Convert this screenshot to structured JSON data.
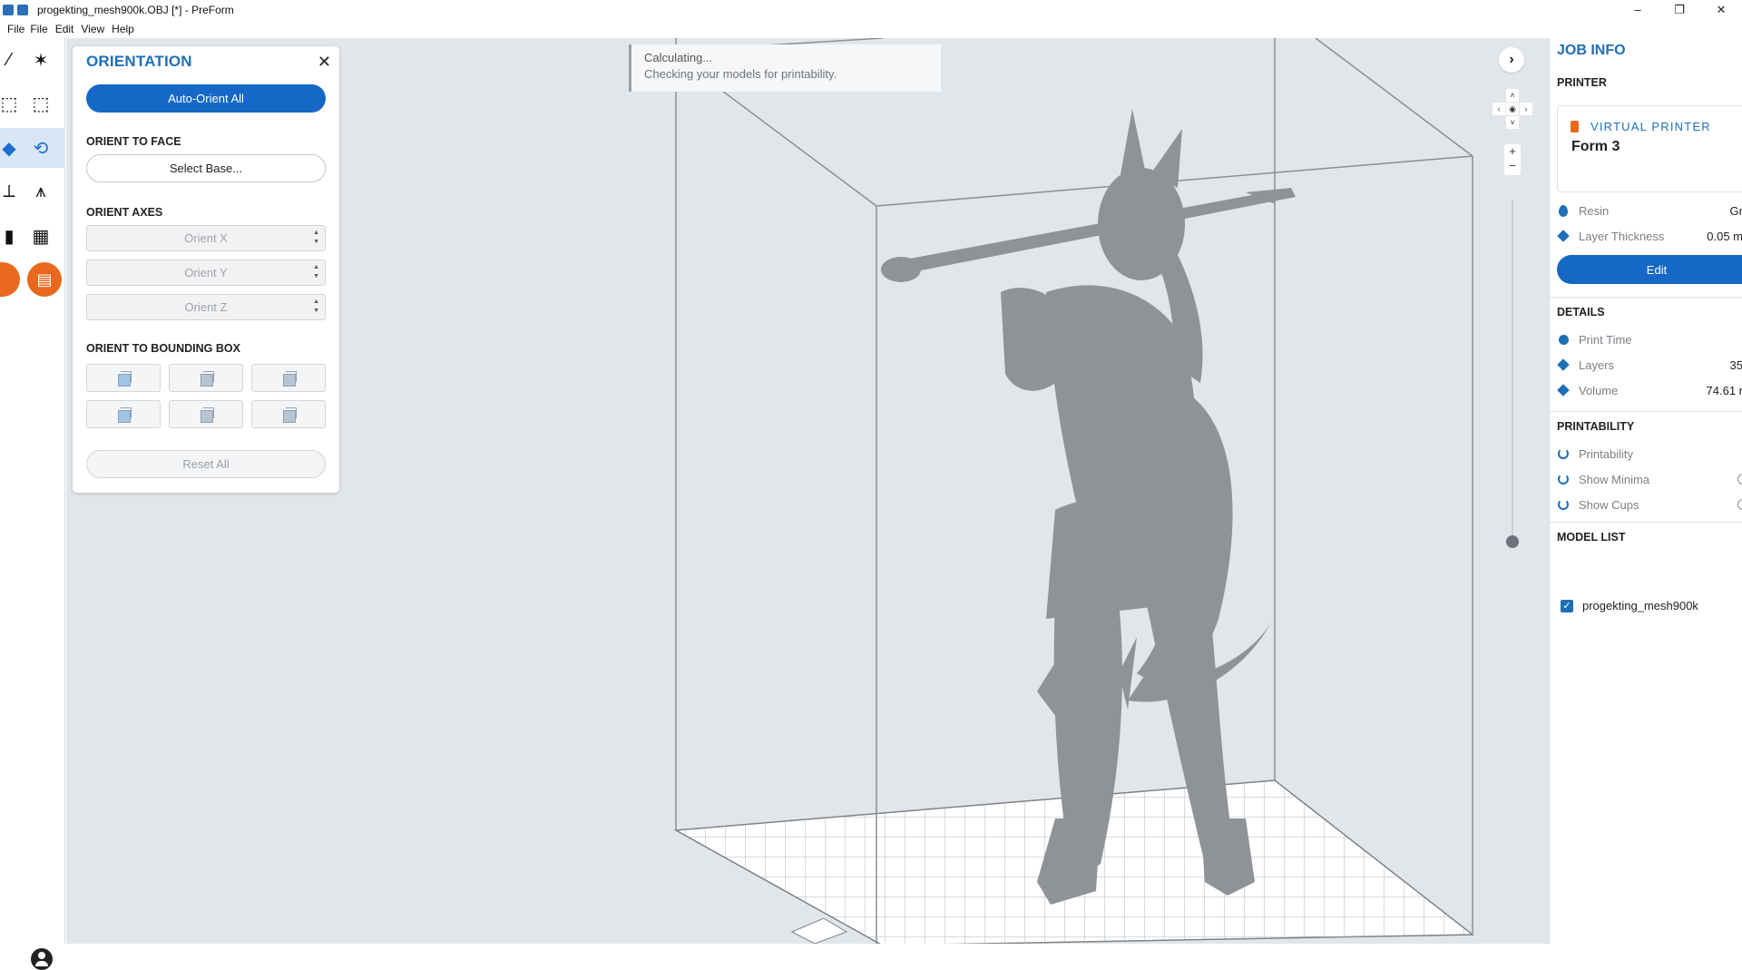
{
  "window": {
    "title": "progekting_mesh900k.OBJ [*] - PreForm",
    "minimize": "–",
    "restore": "❐",
    "close": "✕"
  },
  "menu": [
    "File",
    "File",
    "Edit",
    "View",
    "Help"
  ],
  "orientation_panel": {
    "title": "ORIENTATION",
    "close": "✕",
    "auto_orient": "Auto-Orient All",
    "orient_to_face_label": "ORIENT TO FACE",
    "select_base": "Select Base...",
    "orient_axes_label": "ORIENT AXES",
    "orient_x": "Orient X",
    "orient_y": "Orient Y",
    "orient_z": "Orient Z",
    "orient_bbox_label": "ORIENT TO BOUNDING BOX",
    "reset_all": "Reset All"
  },
  "toast": {
    "title": "Calculating...",
    "message": "Checking your models for printability."
  },
  "job_info": {
    "title": "JOB INFO",
    "printer_label": "PRINTER",
    "virtual_printer": "VIRTUAL PRINTER",
    "printer_name": "Form 3",
    "resin_label": "Resin",
    "resin_value": "Gr",
    "layer_thickness_label": "Layer Thickness",
    "layer_thickness_value": "0.05 m",
    "edit": "Edit",
    "details_label": "DETAILS",
    "print_time_label": "Print Time",
    "layers_label": "Layers",
    "layers_value": "35",
    "volume_label": "Volume",
    "volume_value": "74.61 r",
    "printability_section": "PRINTABILITY",
    "printability_label": "Printability",
    "show_minima": "Show Minima",
    "show_cups": "Show Cups",
    "model_list_label": "MODEL LIST",
    "model_name": "progekting_mesh900k"
  },
  "colors": {
    "accent": "#1668c7",
    "title_blue": "#1f6fb8",
    "orange": "#e8691e",
    "viewport_bg": "#e2e6ea",
    "model_gray": "#8f9296"
  },
  "icons": {
    "toolbar": [
      "wand-icon",
      "magic-wand-icon",
      "select-icon",
      "box-select-icon",
      "orient-icon",
      "orient-rotate-icon",
      "supports-icon",
      "supports-auto-icon",
      "layout-icon",
      "layout-grid-icon",
      "print-icon"
    ],
    "view": [
      "chevron-right-icon",
      "pan-dpad-icon",
      "zoom-in-icon",
      "zoom-out-icon"
    ]
  }
}
